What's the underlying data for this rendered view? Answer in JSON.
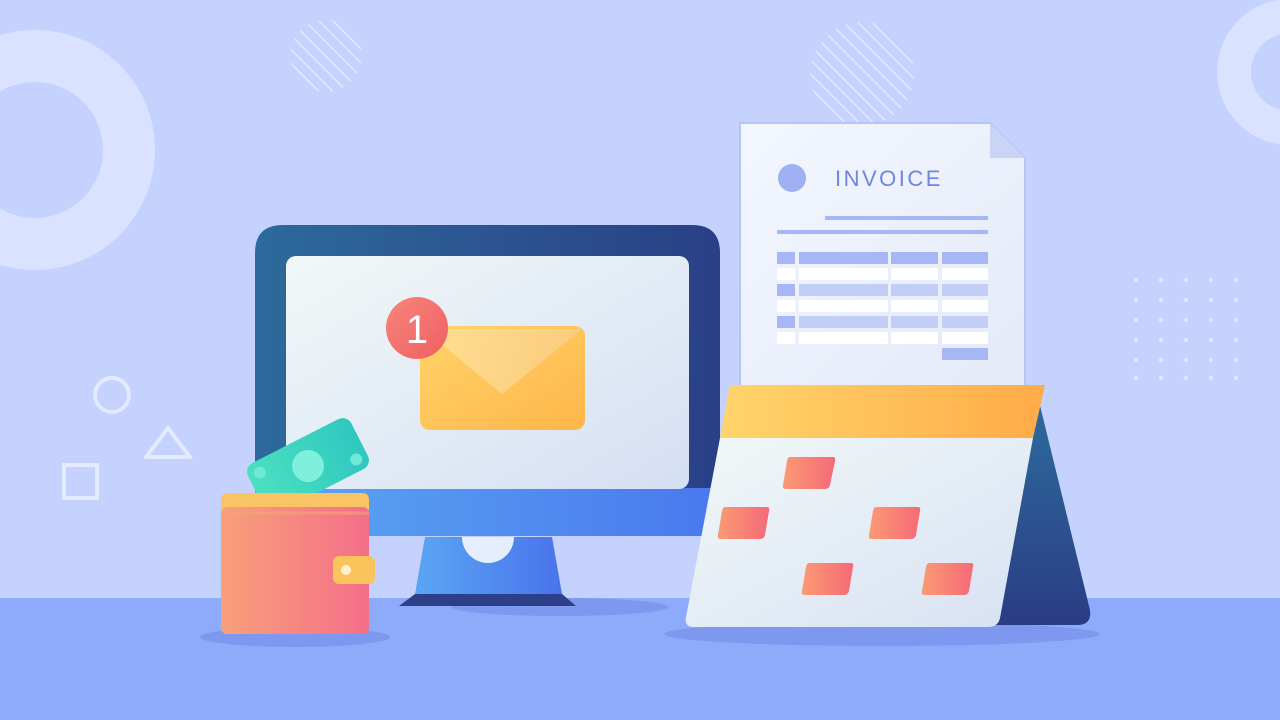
{
  "scene": {
    "invoice_title": "INVOICE",
    "notification_count": "1",
    "colors": {
      "background": "#c5d2fd",
      "floor": "#8eaafa",
      "monitor_frame": "#2b4f8c",
      "envelope": "#ffc35a",
      "badge": "#f4736f",
      "calendar_header": "#ffbe57",
      "calendar_mark": "#f6826f",
      "banknote": "#3ed3c1",
      "wallet": "#f5866e",
      "invoice_accent": "#9fb0f4"
    },
    "icons": [
      "monitor-icon",
      "envelope-icon",
      "invoice-document-icon",
      "calendar-icon",
      "wallet-icon",
      "banknote-icon"
    ]
  }
}
